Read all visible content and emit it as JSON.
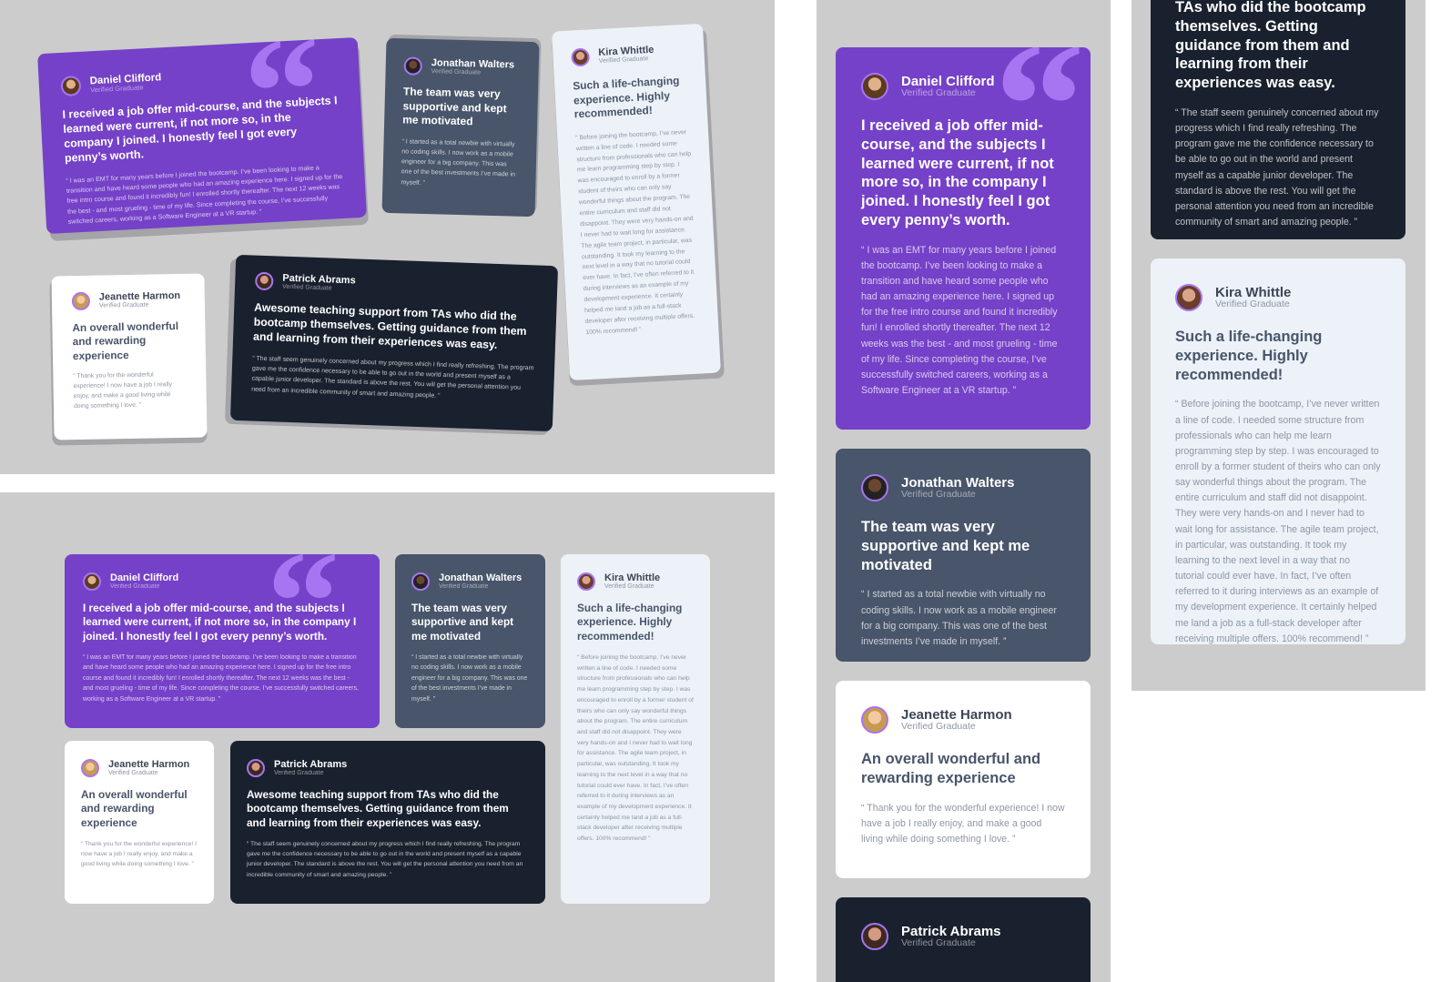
{
  "colors": {
    "background": "#cccccc",
    "purple": "#7541c8",
    "quote_mark": "#a775f1",
    "grayish_blue": "#48556a",
    "dark_blue": "#19212e",
    "white": "#ffffff",
    "light_gray": "#ecf2f8"
  },
  "quote_mark": "“",
  "testimonials": {
    "daniel": {
      "name": "Daniel Clifford",
      "status": "Verified Graduate",
      "avatar_icon": "daniel-avatar",
      "headline": "I received a job offer mid-course, and the subjects I learned were current, if not more so, in the company I joined. I honestly feel I got every penny’s worth.",
      "quote": "“ I was an EMT for many years before I joined the bootcamp. I’ve been looking to make a transition and have heard some people who had an amazing experience here. I signed up for the free intro course and found it incredibly fun! I enrolled shortly thereafter. The next 12 weeks was the best - and most grueling - time of my life. Since completing the course, I’ve successfully switched careers, working as a Software Engineer at a VR startup. ”"
    },
    "jonathan": {
      "name": "Jonathan Walters",
      "status": "Verified Graduate",
      "avatar_icon": "jonathan-avatar",
      "headline": "The team was very supportive and kept me motivated",
      "quote": "“ I started as a total newbie with virtually no coding skills. I now work as a mobile engineer for a big company. This was one of the best investments I’ve made in myself. ”"
    },
    "kira": {
      "name": "Kira Whittle",
      "status": "Verified Graduate",
      "avatar_icon": "kira-avatar",
      "headline": "Such a life-changing experience. Highly recommended!",
      "quote": "“ Before joining the bootcamp, I’ve never written a line of code. I needed some structure from professionals who can help me learn programming step by step. I was encouraged to enroll by a former student of theirs who can only say wonderful things about the program. The entire curriculum and staff did not disappoint. They were very hands-on and I never had to wait long for assistance. The agile team project, in particular, was outstanding. It took my learning to the next level in a way that no tutorial could ever have. In fact, I’ve often referred to it during interviews as an example of my development experience. It certainly helped me land a job as a full-stack developer after receiving multiple offers. 100% recommend! ”"
    },
    "jeanette": {
      "name": "Jeanette Harmon",
      "status": "Verified Graduate",
      "avatar_icon": "jeanette-avatar",
      "headline": "An overall wonderful and rewarding experience",
      "quote": "“ Thank you for the wonderful experience! I now have a job I really enjoy, and make a good living while doing something I love. ”"
    },
    "patrick": {
      "name": "Patrick Abrams",
      "status": "Verified Graduate",
      "avatar_icon": "patrick-avatar",
      "headline": "Awesome teaching support from TAs who did the bootcamp themselves. Getting guidance from them and learning from their experiences was easy.",
      "quote": "“ The staff seem genuinely concerned about my progress which I find really refreshing. The program gave me the confidence necessary to be able to go out in the world and present myself as a capable junior developer. The standard is above the rest. You will get the personal attention you need from an incredible community of smart and amazing people. ”"
    },
    "patrick_clipped_headline": "TAs who did the bootcamp themselves. Getting guidance from them and learning from their experiences was easy."
  }
}
